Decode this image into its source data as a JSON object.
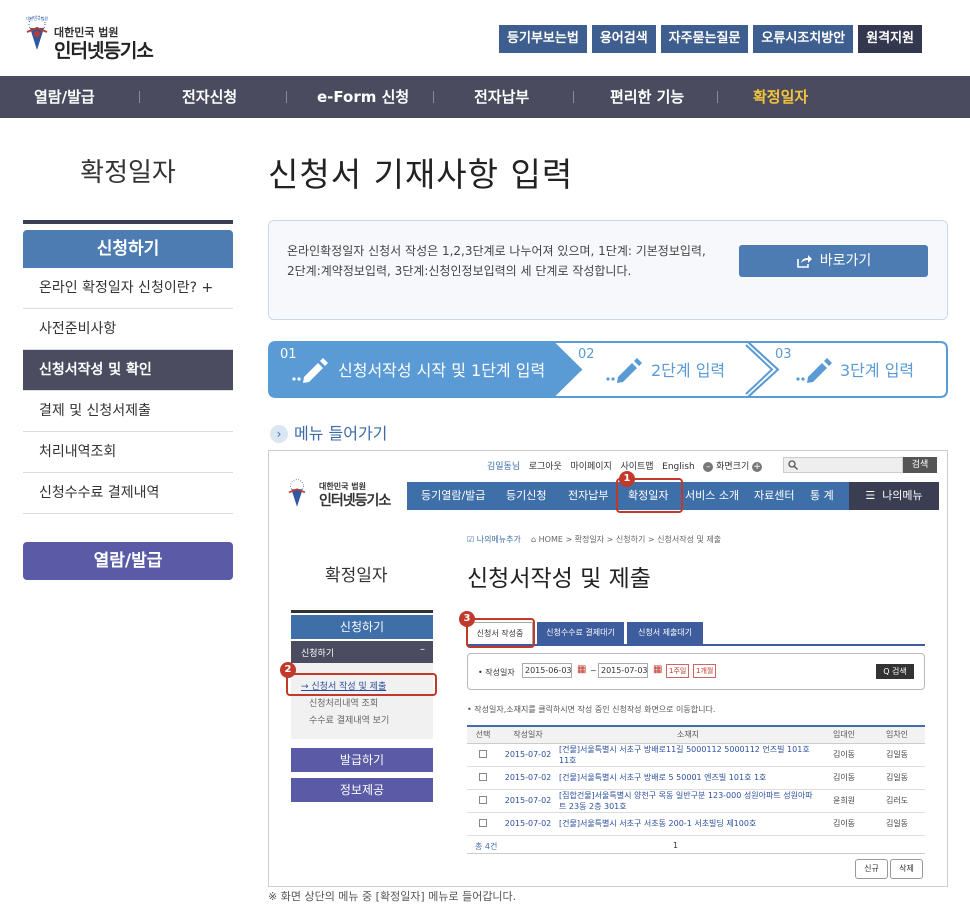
{
  "header": {
    "logo_small": "대한민국 법원",
    "logo_big": "인터넷등기소",
    "logo_seal": "대한민국법원",
    "top_buttons": [
      "등기부보는법",
      "용어검색",
      "자주묻는질문",
      "오류시조치방안",
      "원격지원"
    ]
  },
  "gnb": {
    "items": [
      "열람/발급",
      "전자신청",
      "e-Form 신청",
      "전자납부",
      "편리한 기능",
      "확정일자"
    ],
    "active": "확정일자"
  },
  "lnb": {
    "title": "확정일자",
    "head": "신청하기",
    "items": [
      "온라인 확정일자 신청이란? +",
      "사전준비사항",
      "신청서작성 및 확인",
      "결제 및 신청서제출",
      "처리내역조회",
      "신청수수료 결제내역"
    ],
    "active_index": 2,
    "second_button": "열람/발급"
  },
  "main": {
    "title": "신청서 기재사항 입력",
    "info_text": "온라인확정일자 신청서 작성은 1,2,3단계로 나누어져 있으며, 1단계: 기본정보입력, 2단계:계약정보입력, 3단계:신청인정보입력의 세 단계로 작성합니다.",
    "go_button": "바로가기",
    "steps": [
      {
        "num": "01",
        "label": "신청서작성 시작 및 1단계 입력"
      },
      {
        "num": "02",
        "label": "2단계 입력"
      },
      {
        "num": "03",
        "label": "3단계 입력"
      }
    ],
    "menu_link": "메뉴 들어가기",
    "footnote": "※ 화면 상단의 메뉴 중 [확정일자] 메뉴로 들어갑니다."
  },
  "shot": {
    "top_links": [
      "김일동님",
      "로그아웃",
      "마이페이지",
      "사이트맵",
      "English",
      "화면크기"
    ],
    "search_button": "검색",
    "logo_small": "대한민국 법원",
    "logo_big": "인터넷등기소",
    "gnb": [
      "등기열람/발급",
      "등기신청",
      "전자납부",
      "확정일자",
      "서비스 소개",
      "자료센터",
      "통 계"
    ],
    "my_menu": "나의메뉴",
    "breadcrumb_add": "나의메뉴추가",
    "breadcrumb": "HOME > 확정일자 > 신청하기 > 신청서작성 및 제출",
    "side_title": "확정일자",
    "side_head": "신청하기",
    "side_sub_head": "신청하기",
    "side_sub_items": [
      "→ 신청서 작성 및 제출",
      "신청처리내역 조회",
      "수수료 결제내역 보기"
    ],
    "side_buttons": [
      "발급하기",
      "정보제공"
    ],
    "page_title": "신청서작성 및 제출",
    "tabs": [
      "신청서 작성중",
      "신청수수료 결제대기",
      "신청서 제출대기"
    ],
    "date_label": "• 작성일자",
    "date_from": "2015-06-03",
    "date_to": "2015-07-03",
    "date_btns": [
      "1주일",
      "1개월"
    ],
    "search_btn": "Q 검색",
    "notice": "• 작성일자,소재지를 클릭하시면 작성 중인 신청작성 화면으로 이동합니다.",
    "columns": [
      "선택",
      "작성일자",
      "소재지",
      "임대인",
      "임차인"
    ],
    "rows": [
      {
        "date": "2015-07-02",
        "addr": "[건물]서울특별시 서초구 방배로11길 5000112 5000112 언즈빌 101호 11호",
        "lessor": "김이동",
        "lessee": "김일동"
      },
      {
        "date": "2015-07-02",
        "addr": "[건물]서울특별시 서초구 방배로 5 50001 엔즈빌 101호 1호",
        "lessor": "김이동",
        "lessee": "김일동"
      },
      {
        "date": "2015-07-02",
        "addr": "[집합건물]서울특별시 양천구 목동 일반구분 123-000 성원아파트 성원아파트 23동 2층 301호",
        "lessor": "윤희원",
        "lessee": "김러도"
      },
      {
        "date": "2015-07-02",
        "addr": "[건물]서울특별시 서초구 서초동 200-1 서초빌딩 제100호",
        "lessor": "김이동",
        "lessee": "김일동"
      }
    ],
    "total": "총 4건",
    "page": "1",
    "bottom_buttons": [
      "신규",
      "삭제"
    ],
    "badges": [
      "1",
      "2",
      "3"
    ]
  }
}
